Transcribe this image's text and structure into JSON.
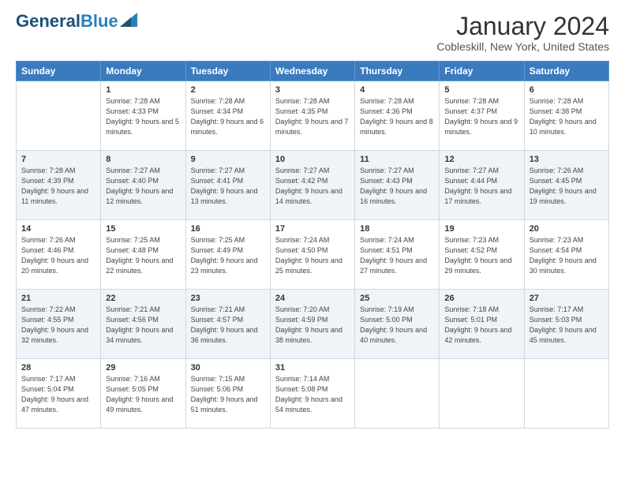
{
  "header": {
    "logo_general": "General",
    "logo_blue": "Blue",
    "month": "January 2024",
    "location": "Cobleskill, New York, United States"
  },
  "weekdays": [
    "Sunday",
    "Monday",
    "Tuesday",
    "Wednesday",
    "Thursday",
    "Friday",
    "Saturday"
  ],
  "weeks": [
    [
      {
        "day": "",
        "sunrise": "",
        "sunset": "",
        "daylight": ""
      },
      {
        "day": "1",
        "sunrise": "Sunrise: 7:28 AM",
        "sunset": "Sunset: 4:33 PM",
        "daylight": "Daylight: 9 hours and 5 minutes."
      },
      {
        "day": "2",
        "sunrise": "Sunrise: 7:28 AM",
        "sunset": "Sunset: 4:34 PM",
        "daylight": "Daylight: 9 hours and 6 minutes."
      },
      {
        "day": "3",
        "sunrise": "Sunrise: 7:28 AM",
        "sunset": "Sunset: 4:35 PM",
        "daylight": "Daylight: 9 hours and 7 minutes."
      },
      {
        "day": "4",
        "sunrise": "Sunrise: 7:28 AM",
        "sunset": "Sunset: 4:36 PM",
        "daylight": "Daylight: 9 hours and 8 minutes."
      },
      {
        "day": "5",
        "sunrise": "Sunrise: 7:28 AM",
        "sunset": "Sunset: 4:37 PM",
        "daylight": "Daylight: 9 hours and 9 minutes."
      },
      {
        "day": "6",
        "sunrise": "Sunrise: 7:28 AM",
        "sunset": "Sunset: 4:38 PM",
        "daylight": "Daylight: 9 hours and 10 minutes."
      }
    ],
    [
      {
        "day": "7",
        "sunrise": "Sunrise: 7:28 AM",
        "sunset": "Sunset: 4:39 PM",
        "daylight": "Daylight: 9 hours and 11 minutes."
      },
      {
        "day": "8",
        "sunrise": "Sunrise: 7:27 AM",
        "sunset": "Sunset: 4:40 PM",
        "daylight": "Daylight: 9 hours and 12 minutes."
      },
      {
        "day": "9",
        "sunrise": "Sunrise: 7:27 AM",
        "sunset": "Sunset: 4:41 PM",
        "daylight": "Daylight: 9 hours and 13 minutes."
      },
      {
        "day": "10",
        "sunrise": "Sunrise: 7:27 AM",
        "sunset": "Sunset: 4:42 PM",
        "daylight": "Daylight: 9 hours and 14 minutes."
      },
      {
        "day": "11",
        "sunrise": "Sunrise: 7:27 AM",
        "sunset": "Sunset: 4:43 PM",
        "daylight": "Daylight: 9 hours and 16 minutes."
      },
      {
        "day": "12",
        "sunrise": "Sunrise: 7:27 AM",
        "sunset": "Sunset: 4:44 PM",
        "daylight": "Daylight: 9 hours and 17 minutes."
      },
      {
        "day": "13",
        "sunrise": "Sunrise: 7:26 AM",
        "sunset": "Sunset: 4:45 PM",
        "daylight": "Daylight: 9 hours and 19 minutes."
      }
    ],
    [
      {
        "day": "14",
        "sunrise": "Sunrise: 7:26 AM",
        "sunset": "Sunset: 4:46 PM",
        "daylight": "Daylight: 9 hours and 20 minutes."
      },
      {
        "day": "15",
        "sunrise": "Sunrise: 7:25 AM",
        "sunset": "Sunset: 4:48 PM",
        "daylight": "Daylight: 9 hours and 22 minutes."
      },
      {
        "day": "16",
        "sunrise": "Sunrise: 7:25 AM",
        "sunset": "Sunset: 4:49 PM",
        "daylight": "Daylight: 9 hours and 23 minutes."
      },
      {
        "day": "17",
        "sunrise": "Sunrise: 7:24 AM",
        "sunset": "Sunset: 4:50 PM",
        "daylight": "Daylight: 9 hours and 25 minutes."
      },
      {
        "day": "18",
        "sunrise": "Sunrise: 7:24 AM",
        "sunset": "Sunset: 4:51 PM",
        "daylight": "Daylight: 9 hours and 27 minutes."
      },
      {
        "day": "19",
        "sunrise": "Sunrise: 7:23 AM",
        "sunset": "Sunset: 4:52 PM",
        "daylight": "Daylight: 9 hours and 29 minutes."
      },
      {
        "day": "20",
        "sunrise": "Sunrise: 7:23 AM",
        "sunset": "Sunset: 4:54 PM",
        "daylight": "Daylight: 9 hours and 30 minutes."
      }
    ],
    [
      {
        "day": "21",
        "sunrise": "Sunrise: 7:22 AM",
        "sunset": "Sunset: 4:55 PM",
        "daylight": "Daylight: 9 hours and 32 minutes."
      },
      {
        "day": "22",
        "sunrise": "Sunrise: 7:21 AM",
        "sunset": "Sunset: 4:56 PM",
        "daylight": "Daylight: 9 hours and 34 minutes."
      },
      {
        "day": "23",
        "sunrise": "Sunrise: 7:21 AM",
        "sunset": "Sunset: 4:57 PM",
        "daylight": "Daylight: 9 hours and 36 minutes."
      },
      {
        "day": "24",
        "sunrise": "Sunrise: 7:20 AM",
        "sunset": "Sunset: 4:59 PM",
        "daylight": "Daylight: 9 hours and 38 minutes."
      },
      {
        "day": "25",
        "sunrise": "Sunrise: 7:19 AM",
        "sunset": "Sunset: 5:00 PM",
        "daylight": "Daylight: 9 hours and 40 minutes."
      },
      {
        "day": "26",
        "sunrise": "Sunrise: 7:18 AM",
        "sunset": "Sunset: 5:01 PM",
        "daylight": "Daylight: 9 hours and 42 minutes."
      },
      {
        "day": "27",
        "sunrise": "Sunrise: 7:17 AM",
        "sunset": "Sunset: 5:03 PM",
        "daylight": "Daylight: 9 hours and 45 minutes."
      }
    ],
    [
      {
        "day": "28",
        "sunrise": "Sunrise: 7:17 AM",
        "sunset": "Sunset: 5:04 PM",
        "daylight": "Daylight: 9 hours and 47 minutes."
      },
      {
        "day": "29",
        "sunrise": "Sunrise: 7:16 AM",
        "sunset": "Sunset: 5:05 PM",
        "daylight": "Daylight: 9 hours and 49 minutes."
      },
      {
        "day": "30",
        "sunrise": "Sunrise: 7:15 AM",
        "sunset": "Sunset: 5:06 PM",
        "daylight": "Daylight: 9 hours and 51 minutes."
      },
      {
        "day": "31",
        "sunrise": "Sunrise: 7:14 AM",
        "sunset": "Sunset: 5:08 PM",
        "daylight": "Daylight: 9 hours and 54 minutes."
      },
      {
        "day": "",
        "sunrise": "",
        "sunset": "",
        "daylight": ""
      },
      {
        "day": "",
        "sunrise": "",
        "sunset": "",
        "daylight": ""
      },
      {
        "day": "",
        "sunrise": "",
        "sunset": "",
        "daylight": ""
      }
    ]
  ]
}
